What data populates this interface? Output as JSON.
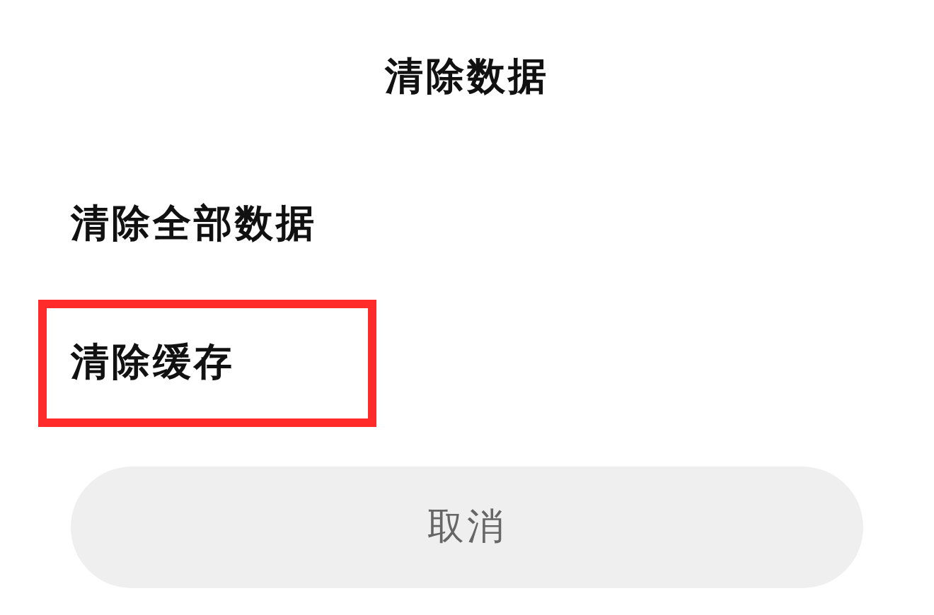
{
  "dialog": {
    "title": "清除数据"
  },
  "options": [
    {
      "label": "清除全部数据",
      "highlighted": false
    },
    {
      "label": "清除缓存",
      "highlighted": true
    }
  ],
  "cancel_button": {
    "label": "取消"
  }
}
